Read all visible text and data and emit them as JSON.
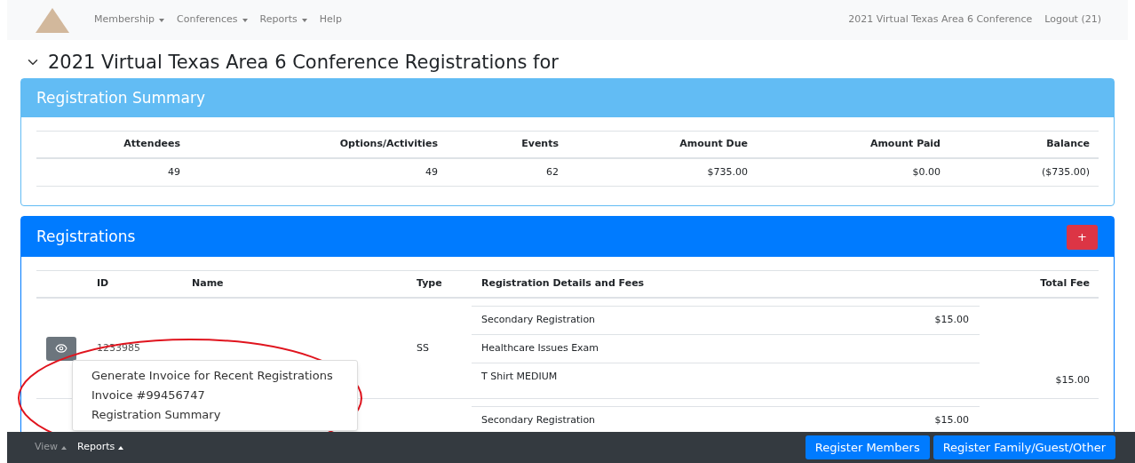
{
  "navbar": {
    "menus": [
      {
        "label": "Membership",
        "dropdown": true
      },
      {
        "label": "Conferences",
        "dropdown": true
      },
      {
        "label": "Reports",
        "dropdown": true
      },
      {
        "label": "Help",
        "dropdown": false
      }
    ],
    "conference": "2021 Virtual Texas Area 6 Conference",
    "logout": "Logout (21)"
  },
  "title": {
    "text": "2021 Virtual Texas Area 6 Conference Registrations for",
    "expanded": true
  },
  "summary": {
    "title": "Registration Summary",
    "columns": [
      "Attendees",
      "Options/Activities",
      "Events",
      "Amount Due",
      "Amount Paid",
      "Balance"
    ],
    "values": [
      "49",
      "49",
      "62",
      "$735.00",
      "$0.00",
      "($735.00)"
    ]
  },
  "registrations": {
    "title": "Registrations",
    "add_button": "+",
    "columns": [
      "ID",
      "Name",
      "Type",
      "Registration Details and Fees",
      "Total Fee"
    ],
    "rows": [
      {
        "id": "1233985",
        "type": "SS",
        "items": [
          {
            "label": "Secondary Registration",
            "fee": "$15.00"
          },
          {
            "label": "Healthcare Issues Exam"
          },
          {
            "label": "T Shirt MEDIUM"
          }
        ],
        "total": "$15.00"
      },
      {
        "items": [
          {
            "label": "Secondary Registration",
            "fee": "$15.00"
          }
        ]
      }
    ]
  },
  "reports_menu": {
    "items": [
      "Generate Invoice for Recent Registrations",
      "Invoice #99456747",
      "Registration Summary"
    ]
  },
  "footer": {
    "menus": [
      {
        "label": "View",
        "selected": false
      },
      {
        "label": "Reports",
        "selected": true
      }
    ],
    "buttons": [
      "Register Members",
      "Register Family/Guest/Other"
    ]
  }
}
